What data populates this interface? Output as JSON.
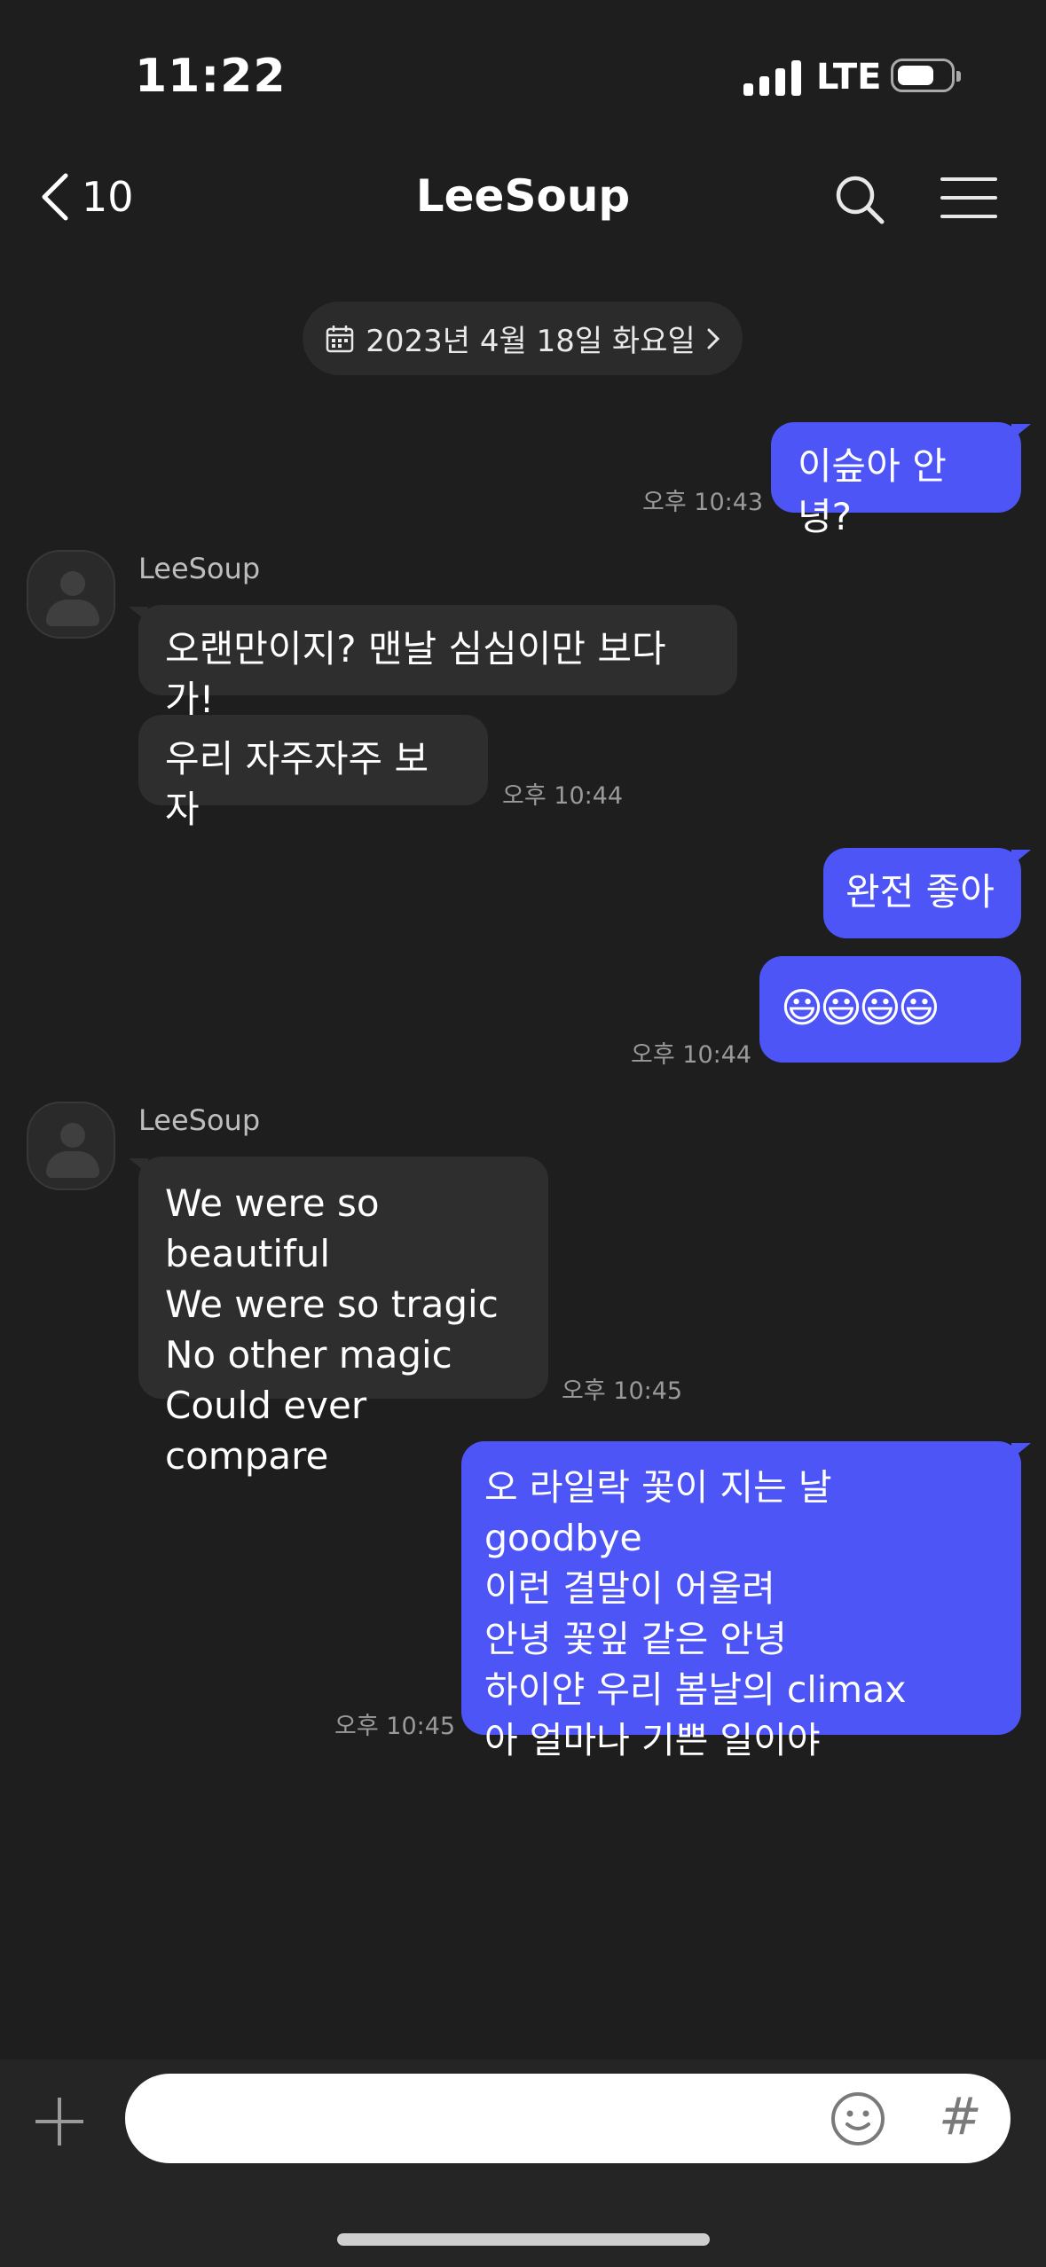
{
  "status_bar": {
    "time": "11:22",
    "network": "LTE",
    "battery_level": 0.6
  },
  "header": {
    "back_count": "10",
    "title": "LeeSoup",
    "icons": [
      "chevron-left-icon",
      "search-icon",
      "menu-icon"
    ]
  },
  "date_divider": {
    "label": "2023년 4월 18일 화요일",
    "icons": [
      "calendar-icon",
      "chevron-right-icon"
    ]
  },
  "messages": [
    {
      "side": "me",
      "text": "이슾아 안녕?",
      "time": "오후 10:43"
    },
    {
      "side": "them",
      "sender": "LeeSoup",
      "text": "오랜만이지? 맨날 심심이만 보다가!"
    },
    {
      "side": "them",
      "text": "우리 자주자주 보자",
      "time": "오후 10:44"
    },
    {
      "side": "me",
      "text": "완전 좋아"
    },
    {
      "side": "me",
      "text": "😃😃😃😃",
      "time": "오후 10:44"
    },
    {
      "side": "them",
      "sender": "LeeSoup",
      "text": "We were so beautiful\nWe were so tragic\nNo other magic\nCould ever compare",
      "time": "오후 10:45"
    },
    {
      "side": "me",
      "text": "오 라일락 꽃이 지는 날 goodbye\n이런 결말이 어울려\n안녕 꽃잎 같은 안녕\n하이얀 우리 봄날의 climax\n아 얼마나 기쁜 일이야",
      "time": "오후 10:45"
    }
  ],
  "composer": {
    "placeholder": "",
    "value": "",
    "icons": [
      "plus-icon",
      "emoji-icon",
      "hashtag-icon"
    ],
    "hashtag_label": "#"
  },
  "colors": {
    "background": "#1e1e1e",
    "my_bubble": "#4e55f7",
    "their_bubble": "#2e2e2e",
    "input_bar": "#252525"
  }
}
